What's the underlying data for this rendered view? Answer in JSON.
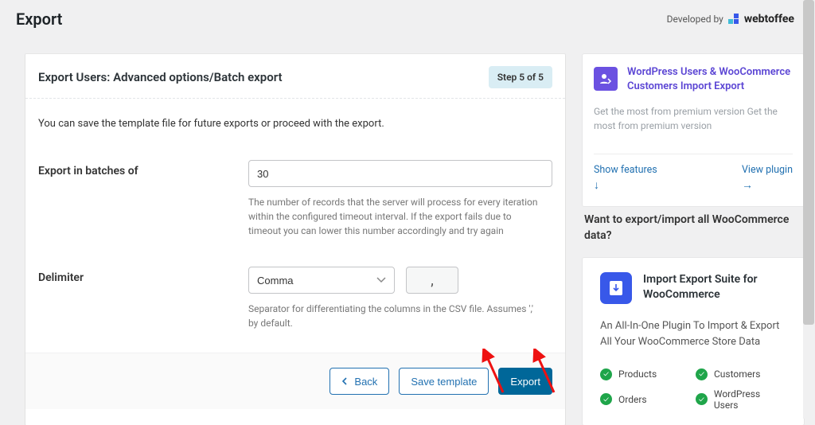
{
  "page": {
    "title": "Export"
  },
  "branding": {
    "prefix": "Developed by",
    "name": "webtoffee"
  },
  "card": {
    "title": "Export Users: Advanced options/Batch export",
    "step_badge": "Step 5 of 5",
    "intro": "You can save the template file for future exports or proceed with the export.",
    "batch": {
      "label": "Export in batches of",
      "value": "30",
      "help": "The number of records that the server will process for every iteration within the configured timeout interval. If the export fails due to timeout you can lower this number accordingly and try again"
    },
    "delimiter": {
      "label": "Delimiter",
      "selected": "Comma",
      "symbol": ",",
      "help": "Separator for differentiating the columns in the CSV file. Assumes ',' by default."
    },
    "buttons": {
      "back": "Back",
      "save": "Save template",
      "export": "Export"
    }
  },
  "sidebar": {
    "promo1": {
      "title": "WordPress Users & WooCommerce Customers Import Export",
      "desc": "Get the most from premium version Get the most from premium version",
      "link_features": "Show features",
      "link_view": "View plugin"
    },
    "midtext": "Want to export/import all WooCommerce data?",
    "promo2": {
      "title": "Import Export Suite for WooCommerce",
      "desc": "An All-In-One Plugin To Import & Export All Your WooCommerce Store Data",
      "features": [
        "Products",
        "Customers",
        "Orders",
        "WordPress Users"
      ]
    }
  }
}
